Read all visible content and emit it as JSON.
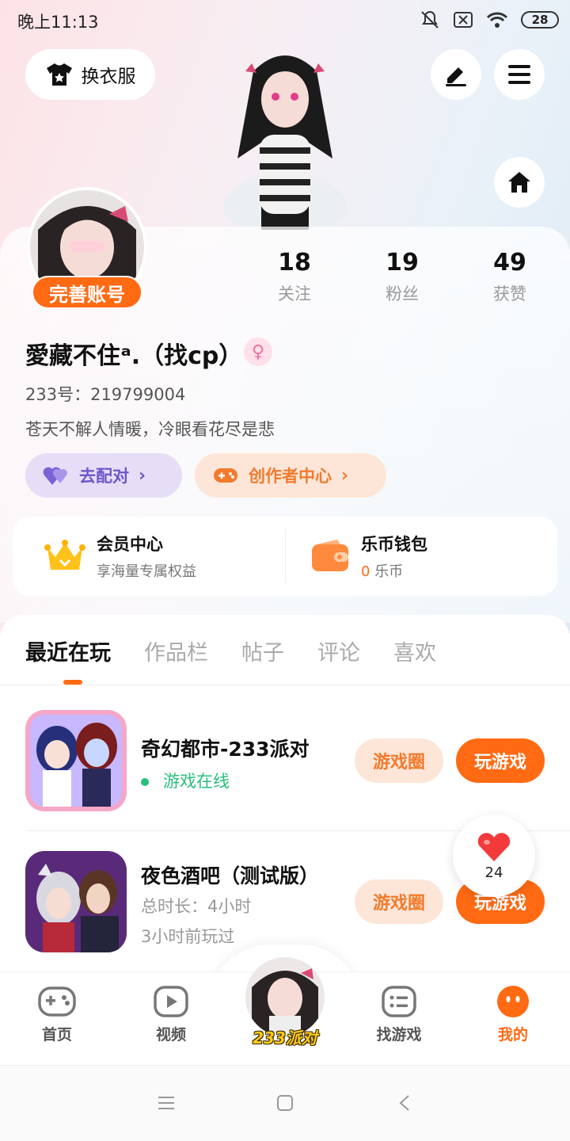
{
  "status_bar": {
    "time": "晚上11:13",
    "battery": "28"
  },
  "header": {
    "dress_label": "换衣服"
  },
  "profile": {
    "complete_label": "完善账号",
    "stats": [
      {
        "value": "18",
        "label": "关注"
      },
      {
        "value": "19",
        "label": "粉丝"
      },
      {
        "value": "49",
        "label": "获赞"
      }
    ],
    "name": "愛藏不住ᵃ.（找cp）",
    "gender_symbol": "♀",
    "uid": "233号：219799004",
    "bio": "苍天不解人情暖，冷眼看花尽是悲",
    "match_label": "去配对",
    "creator_label": "创作者中心"
  },
  "wallet": {
    "vip_title": "会员中心",
    "vip_sub": "享海量专属权益",
    "coin_title": "乐币钱包",
    "coin_value": "0",
    "coin_unit": "乐币"
  },
  "tabs": [
    "最近在玩",
    "作品栏",
    "帖子",
    "评论",
    "喜欢"
  ],
  "games": [
    {
      "title": "奇幻都市-233派对",
      "status": "游戏在线",
      "circle": "游戏圈",
      "play": "玩游戏"
    },
    {
      "title": "夜色酒吧（测试版）",
      "duration": "总时长：4小时",
      "last_played": "3小时前玩过",
      "circle": "游戏圈",
      "play": "玩游戏"
    }
  ],
  "like_bubble": {
    "count": "24"
  },
  "bottom_nav": {
    "home": "首页",
    "video": "视频",
    "center": "233派对",
    "find": "找游戏",
    "mine": "我的"
  },
  "colors": {
    "accent": "#ff6a13",
    "online": "#27c07b",
    "match_purple": "#6e57c9"
  }
}
